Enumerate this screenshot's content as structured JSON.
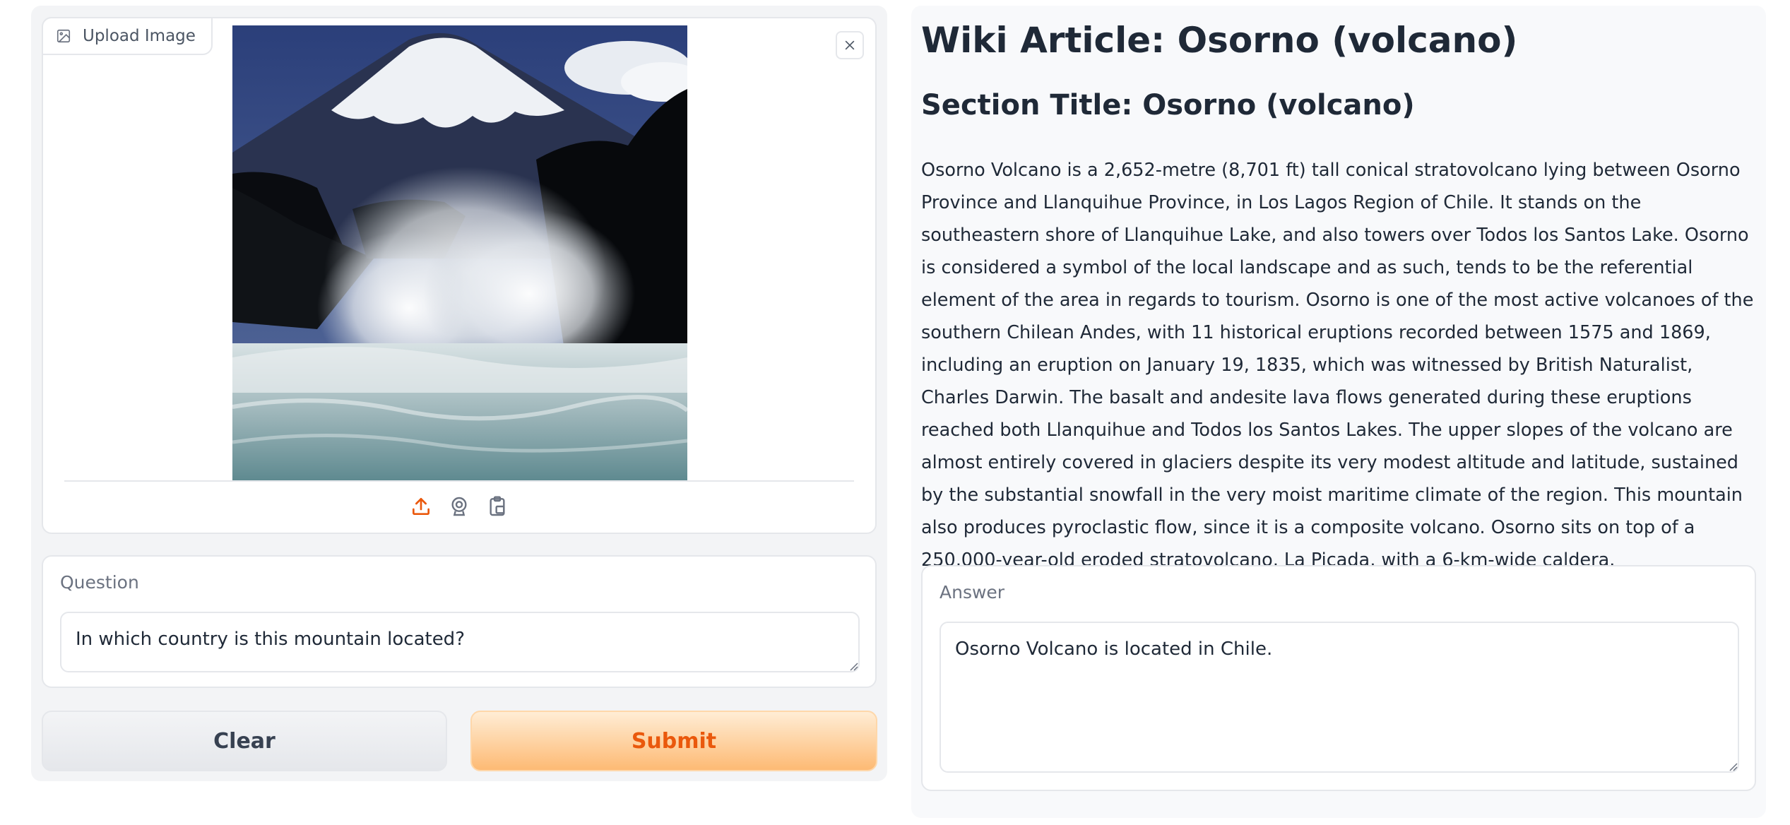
{
  "upload": {
    "label": "Upload Image",
    "icons": [
      "image-icon",
      "close-icon",
      "upload-icon",
      "webcam-icon",
      "clipboard-icon"
    ],
    "accent_color": "#ea580c"
  },
  "question": {
    "label": "Question",
    "value": "In which country is this mountain located?"
  },
  "buttons": {
    "clear_label": "Clear",
    "submit_label": "Submit"
  },
  "article": {
    "title": "Wiki Article: Osorno (volcano)",
    "section_title": "Section Title: Osorno (volcano)",
    "body": "Osorno Volcano is a 2,652-metre (8,701 ft) tall conical stratovolcano lying between Osorno Province and Llanquihue Province, in Los Lagos Region of Chile. It stands on the southeastern shore of Llanquihue Lake, and also towers over Todos los Santos Lake. Osorno is considered a symbol of the local landscape and as such, tends to be the referential element of the area in regards to tourism. Osorno is one of the most active volcanoes of the southern Chilean Andes, with 11 historical eruptions recorded between 1575 and 1869, including an eruption on January 19, 1835, which was witnessed by British Naturalist, Charles Darwin. The basalt and andesite lava flows generated during these eruptions reached both Llanquihue and Todos los Santos Lakes. The upper slopes of the volcano are almost entirely covered in glaciers despite its very modest altitude and latitude, sustained by the substantial snowfall in the very moist maritime climate of the region. This mountain also produces pyroclastic flow, since it is a composite volcano. Osorno sits on top of a 250,000-year-old eroded stratovolcano, La Picada, with a 6-km-wide caldera."
  },
  "answer": {
    "label": "Answer",
    "value": "Osorno Volcano is located in Chile."
  }
}
